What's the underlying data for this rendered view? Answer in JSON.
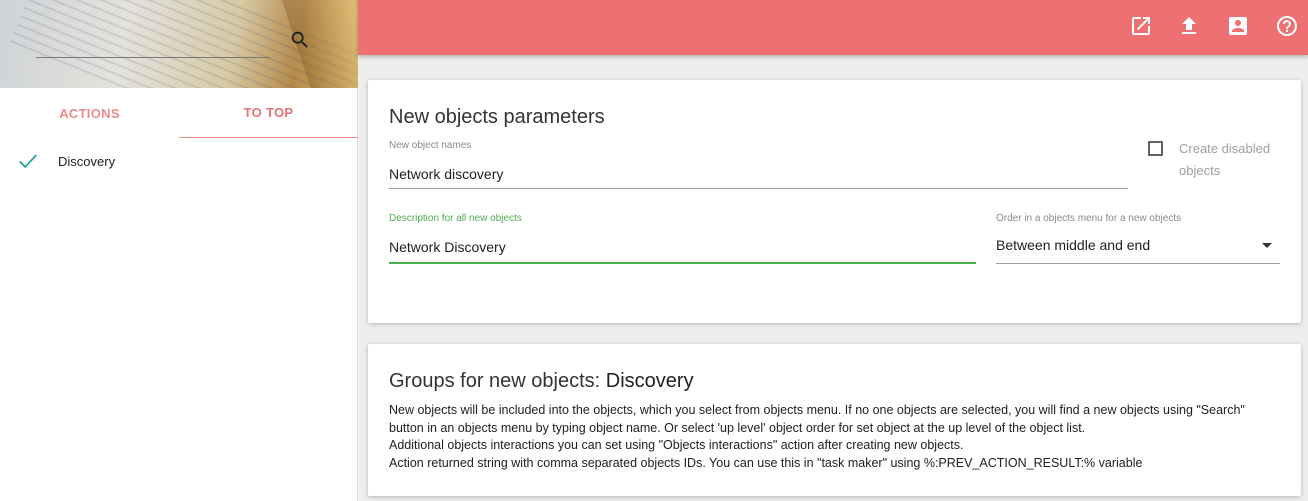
{
  "sidebar": {
    "search": {
      "placeholder": "",
      "value": ""
    },
    "tabs": [
      {
        "label": "ACTIONS"
      },
      {
        "label": "TO TOP"
      }
    ],
    "items": [
      {
        "label": "Discovery",
        "checked": true
      }
    ]
  },
  "topbar": {
    "icons": [
      "open-in-new-icon",
      "upload-icon",
      "account-box-icon",
      "help-icon"
    ]
  },
  "params_card": {
    "title": "New objects parameters",
    "names_label": "New object names",
    "names_value": "Network discovery",
    "create_disabled_label": "Create disabled objects",
    "description_label": "Description for all new objects",
    "description_value": "Network Discovery",
    "order_label": "Order in a objects menu for a new objects",
    "order_value": "Between middle and end"
  },
  "groups_card": {
    "title_prefix": "Groups for new objects: ",
    "title_object": "Discovery",
    "lines": [
      "New objects will be included into the objects, which you select from objects menu. If no one objects are selected, you will find a new objects using \"Search\" button in an objects menu by typing object name. Or select 'up level' object order for set object at the up level of the object list.",
      "Additional objects interactions you can set using \"Objects interactions\" action after creating new objects.",
      "Action returned string with comma separated objects IDs. You can use this in \"task maker\" using %:PREV_ACTION_RESULT:% variable"
    ]
  },
  "colors": {
    "topbar": "#ef7073",
    "tab_text": "#ef8a8a",
    "check": "#26a69a",
    "focus": "#4caf50"
  }
}
